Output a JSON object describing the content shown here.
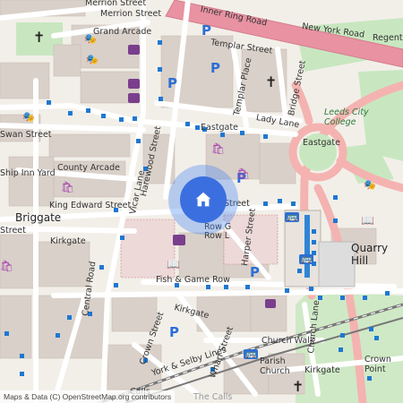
{
  "map": {
    "attribution": "Maps & Data (C) OpenStreetMap.org contributors",
    "colors": {
      "land": "#f2efe9",
      "building": "#d9d0c9",
      "road": "#ffffff",
      "primary_road": "#f4b3b0",
      "ring_road": "#e892a2",
      "green": "#c8e7c0",
      "rail": "#777777",
      "location": "#3b6fe0"
    },
    "streets": {
      "merrion_street": "Merrion Street",
      "merrion_street_top": "Merrion Street",
      "grand_arcade": "Grand Arcade",
      "inner_ring_road": "Inner Ring Road",
      "new_york_road": "New York Road",
      "regent_street": "Regent Street",
      "templar_street": "Templar Street",
      "templar_place": "Templar Place",
      "templar_lane": "Templar Lane",
      "bridge_street": "Bridge Street",
      "lady_lane": "Lady Lane",
      "eastgate": "Eastgate",
      "eastgate_2": "Eastgate",
      "swan_street": "Swan Street",
      "county_arcade": "County Arcade",
      "ship_inn_yard": "Ship Inn Yard",
      "briggate": "Briggate",
      "king_edward_street": "King Edward Street",
      "harewood_street": "Harewood Street",
      "vicar_lane": "Vicar Lane",
      "kirkgate": "Kirkgate",
      "kirkgate_2": "Kirkgate",
      "kirkgate_3": "Kirkgate",
      "street_left": "Street",
      "row_g": "Row G",
      "row_l": "Row L",
      "harper_street": "Harper Street",
      "fish_game_row": "Fish & Game Row",
      "central_road": "Central Road",
      "crown_street": "Crown Street",
      "york_selby_lines": "York & Selby Lines",
      "wharf_street": "Wharf Street",
      "church_walk": "Church Walk",
      "church_lane": "Church Lane",
      "the_calls": "The Calls",
      "calls": "Calls",
      "street_partial": "Street"
    },
    "places": {
      "leeds_city_college": "Leeds City College",
      "quarry_hill": "Quarry Hill",
      "parish_church": "Parish Church",
      "crown_point": "Crown Point"
    },
    "icons": {
      "parking": "P",
      "location_marker": "home-icon"
    }
  }
}
